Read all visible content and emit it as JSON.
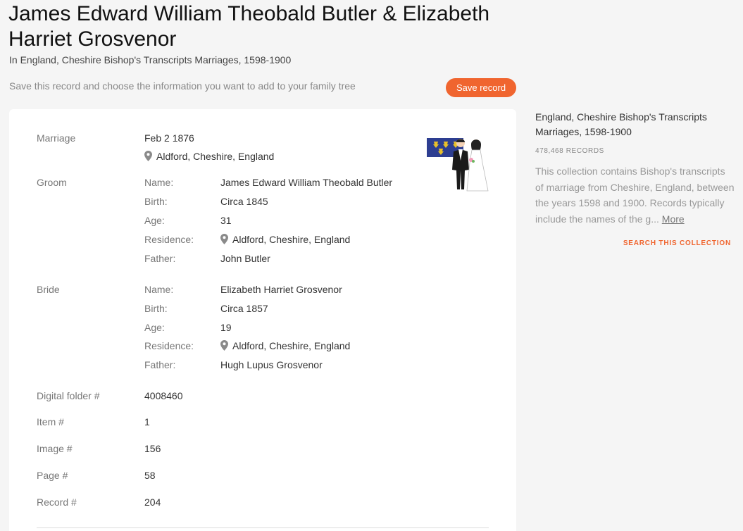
{
  "header": {
    "title": "James Edward William Theobald Butler & Elizabeth Harriet Grosvenor",
    "subtitle": "In England, Cheshire Bishop's Transcripts Marriages, 1598-1900",
    "save_hint": "Save this record and choose the information you want to add to your family tree",
    "save_button": "Save record"
  },
  "record": {
    "marriage": {
      "label": "Marriage",
      "date": "Feb 2 1876",
      "place": "Aldford, Cheshire, England"
    },
    "groom": {
      "label": "Groom",
      "fields": [
        {
          "label": "Name:",
          "value": "James Edward William Theobald Butler"
        },
        {
          "label": "Birth:",
          "value": "Circa 1845"
        },
        {
          "label": "Age:",
          "value": "31"
        },
        {
          "label": "Residence:",
          "value": "Aldford, Cheshire, England"
        },
        {
          "label": "Father:",
          "value": "John Butler"
        }
      ]
    },
    "bride": {
      "label": "Bride",
      "fields": [
        {
          "label": "Name:",
          "value": "Elizabeth Harriet Grosvenor"
        },
        {
          "label": "Birth:",
          "value": "Circa 1857"
        },
        {
          "label": "Age:",
          "value": "19"
        },
        {
          "label": "Residence:",
          "value": "Aldford, Cheshire, England"
        },
        {
          "label": "Father:",
          "value": "Hugh Lupus Grosvenor"
        }
      ]
    },
    "details": [
      {
        "label": "Digital folder #",
        "value": "4008460"
      },
      {
        "label": "Item #",
        "value": "1"
      },
      {
        "label": "Image #",
        "value": "156"
      },
      {
        "label": "Page #",
        "value": "58"
      },
      {
        "label": "Record #",
        "value": "204"
      }
    ]
  },
  "sidebar": {
    "collection_title": "England, Cheshire Bishop's Transcripts Marriages, 1598-1900",
    "records_count": "478,468 RECORDS",
    "description": "This collection contains Bishop's transcripts of marriage from Cheshire, England, between the years 1598 and 1900. Records typically include the names of the g...",
    "more_link": "More",
    "search_link": "SEARCH THIS COLLECTION"
  },
  "icons": {
    "location": "map-pin-icon",
    "illustration": "wedding-couple-illustration"
  },
  "colors": {
    "accent": "#f0652f",
    "background": "#f5f5f5",
    "card": "#ffffff",
    "flag_blue": "#2d3e91",
    "flag_gold": "#e8c02a"
  }
}
